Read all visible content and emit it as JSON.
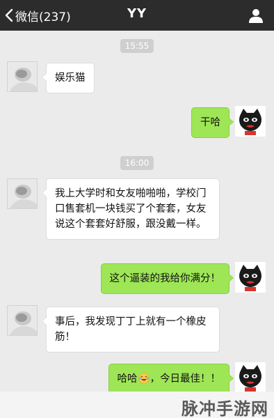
{
  "header": {
    "back_label": "微信(237)",
    "title": "YY",
    "back_icon": "chevron-left-icon",
    "profile_icon": "person-icon"
  },
  "chat": {
    "timestamps": [
      "15:55",
      "16:00"
    ],
    "messages": [
      {
        "side": "in",
        "text": "娱乐猫"
      },
      {
        "side": "out",
        "text": "干哈"
      },
      {
        "side": "in",
        "text": "我上大学时和女友啪啪啪，学校门口售套机一块钱买了个套套，女友说这个套套好舒服，跟没戴一样。"
      },
      {
        "side": "out",
        "text": "这个逼装的我给你满分！"
      },
      {
        "side": "in",
        "text": "事后，我发现丁丁上就有一个橡皮筋！"
      },
      {
        "side": "out",
        "text_before": "哈哈",
        "emoji": "laughing-tears-emoji",
        "text_after": "，今日最佳！！"
      }
    ]
  },
  "watermark": "脉冲手游网",
  "colors": {
    "topbar": "#2c2c2c",
    "background": "#ebebeb",
    "outgoing_bubble": "#9ee656",
    "incoming_bubble": "#ffffff",
    "timestamp": "#cfcfcf"
  }
}
